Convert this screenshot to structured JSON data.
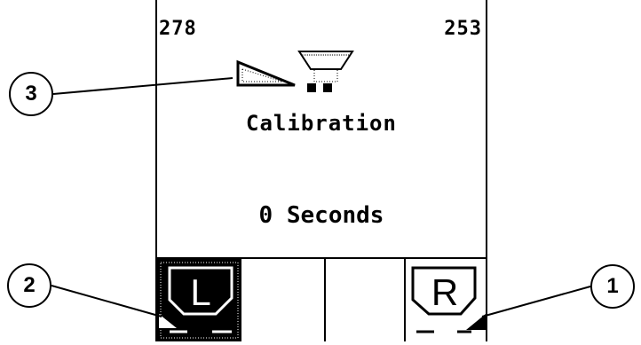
{
  "counters": {
    "left": "278",
    "right": "253"
  },
  "screen": {
    "title": "Calibration",
    "time": "0 Seconds"
  },
  "softkeys": {
    "left_letter": "L",
    "right_letter": "R"
  },
  "callouts": {
    "one": "1",
    "two": "2",
    "three": "3"
  },
  "colors": {
    "foreground": "#000000",
    "background": "#ffffff"
  }
}
